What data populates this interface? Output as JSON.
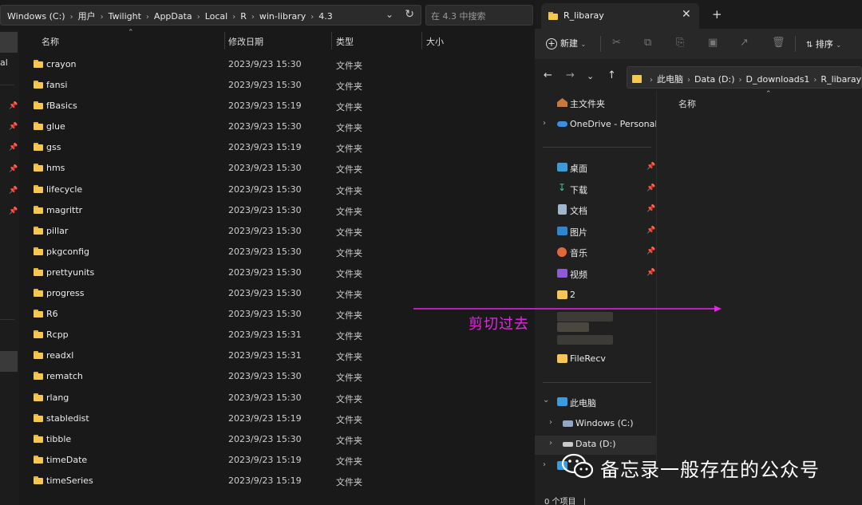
{
  "left": {
    "breadcrumb": [
      "Windows (C:)",
      "用户",
      "Twilight",
      "AppData",
      "Local",
      "R",
      "win-library",
      "4.3"
    ],
    "search_placeholder": "在 4.3 中搜索",
    "nav_partial_label": "al",
    "columns": {
      "name": "名称",
      "date": "修改日期",
      "type": "类型",
      "size": "大小"
    },
    "rows": [
      {
        "name": "crayon",
        "date": "2023/9/23 15:30",
        "type": "文件夹"
      },
      {
        "name": "fansi",
        "date": "2023/9/23 15:30",
        "type": "文件夹"
      },
      {
        "name": "fBasics",
        "date": "2023/9/23 15:19",
        "type": "文件夹"
      },
      {
        "name": "glue",
        "date": "2023/9/23 15:30",
        "type": "文件夹"
      },
      {
        "name": "gss",
        "date": "2023/9/23 15:19",
        "type": "文件夹"
      },
      {
        "name": "hms",
        "date": "2023/9/23 15:30",
        "type": "文件夹"
      },
      {
        "name": "lifecycle",
        "date": "2023/9/23 15:30",
        "type": "文件夹"
      },
      {
        "name": "magrittr",
        "date": "2023/9/23 15:30",
        "type": "文件夹"
      },
      {
        "name": "pillar",
        "date": "2023/9/23 15:30",
        "type": "文件夹"
      },
      {
        "name": "pkgconfig",
        "date": "2023/9/23 15:30",
        "type": "文件夹"
      },
      {
        "name": "prettyunits",
        "date": "2023/9/23 15:30",
        "type": "文件夹"
      },
      {
        "name": "progress",
        "date": "2023/9/23 15:30",
        "type": "文件夹"
      },
      {
        "name": "R6",
        "date": "2023/9/23 15:30",
        "type": "文件夹"
      },
      {
        "name": "Rcpp",
        "date": "2023/9/23 15:31",
        "type": "文件夹"
      },
      {
        "name": "readxl",
        "date": "2023/9/23 15:31",
        "type": "文件夹"
      },
      {
        "name": "rematch",
        "date": "2023/9/23 15:30",
        "type": "文件夹"
      },
      {
        "name": "rlang",
        "date": "2023/9/23 15:30",
        "type": "文件夹"
      },
      {
        "name": "stabledist",
        "date": "2023/9/23 15:19",
        "type": "文件夹"
      },
      {
        "name": "tibble",
        "date": "2023/9/23 15:30",
        "type": "文件夹"
      },
      {
        "name": "timeDate",
        "date": "2023/9/23 15:19",
        "type": "文件夹"
      },
      {
        "name": "timeSeries",
        "date": "2023/9/23 15:19",
        "type": "文件夹"
      }
    ]
  },
  "right": {
    "tab_title": "R_libaray",
    "toolbar": {
      "new_label": "新建",
      "sort_label": "排序"
    },
    "breadcrumb": [
      "此电脑",
      "Data (D:)",
      "D_downloads1",
      "R_libaray"
    ],
    "sidebar": {
      "home": "主文件夹",
      "onedrive": "OneDrive - Personal",
      "desktop": "桌面",
      "downloads": "下载",
      "documents": "文档",
      "pictures": "图片",
      "music": "音乐",
      "videos": "视频",
      "folder2": "2",
      "filerecv": "FileRecv",
      "thispc": "此电脑",
      "drive_c": "Windows (C:)",
      "drive_d": "Data (D:)"
    },
    "column_name": "名称",
    "status": "0 个项目"
  },
  "overlay": {
    "caption": "剪切过去",
    "watermark": "备忘录一般存在的公众号",
    "arrow_color": "#e228e2"
  }
}
